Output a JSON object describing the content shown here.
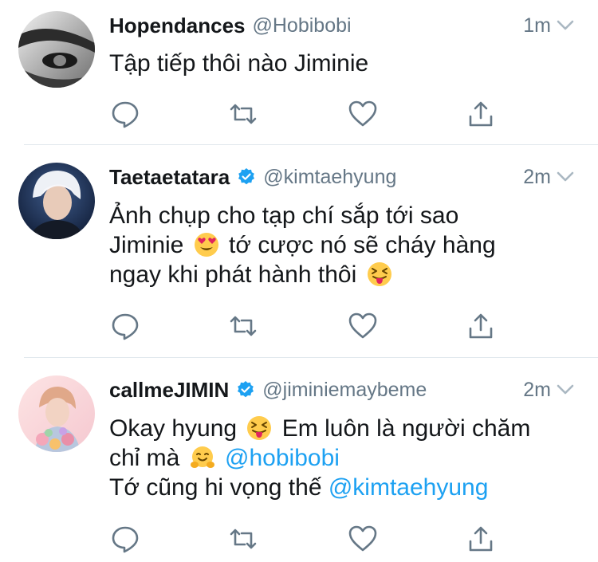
{
  "tweets": [
    {
      "name": "Hopendances",
      "handle": "@Hobibobi",
      "time": "1m",
      "verified": false,
      "lines": [
        [
          {
            "t": "Tập tiếp thôi nào Jiminie"
          }
        ]
      ]
    },
    {
      "name": "Taetaetatara",
      "handle": "@kimtaehyung",
      "time": "2m",
      "verified": true,
      "lines": [
        [
          {
            "t": "Ảnh chụp cho tạp chí sắp tới sao"
          }
        ],
        [
          {
            "t": "Jiminie "
          },
          {
            "emoji": "heart-eyes"
          },
          {
            "t": " tớ cược nó sẽ cháy hàng"
          }
        ],
        [
          {
            "t": "ngay khi phát hành thôi "
          },
          {
            "emoji": "squint-tongue"
          }
        ]
      ]
    },
    {
      "name": "callmeJIMIN",
      "handle": "@jiminiemaybeme",
      "time": "2m",
      "verified": true,
      "lines": [
        [
          {
            "t": "Okay hyung "
          },
          {
            "emoji": "squint-tongue"
          },
          {
            "t": " Em luôn là người chăm"
          }
        ],
        [
          {
            "t": "chỉ mà "
          },
          {
            "emoji": "hugging"
          },
          {
            "t": " "
          },
          {
            "m": "@hobibobi"
          }
        ],
        [
          {
            "t": "Tớ cũng hi vọng thế "
          },
          {
            "m": "@kimtaehyung"
          }
        ]
      ]
    }
  ],
  "icons": {
    "reply": "reply-icon",
    "retweet": "retweet-icon",
    "like": "like-icon",
    "share": "share-icon",
    "verified": "verified-badge-icon",
    "chevron": "chevron-down-icon"
  },
  "colors": {
    "text": "#14171a",
    "muted": "#657786",
    "link": "#1da1f2",
    "divider": "#e1e8ed"
  }
}
